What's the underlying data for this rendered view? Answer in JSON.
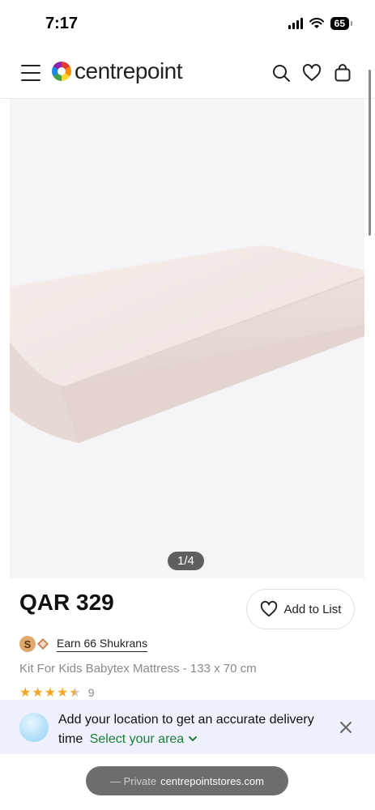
{
  "status_bar": {
    "time": "7:17",
    "battery": "65"
  },
  "header": {
    "logo_text": "centrepoint",
    "icons": [
      "menu-icon",
      "search-icon",
      "heart-icon",
      "bag-icon"
    ]
  },
  "gallery": {
    "pager": "1/4"
  },
  "product": {
    "price": "QAR 329",
    "add_to_list": "Add to List",
    "shukran_coin": "S",
    "shukran_label": "Earn 66 Shukrans",
    "title": "Kit For Kids Babytex Mattress - 133 x 70 cm",
    "rating_value": 4.5,
    "rating_count": "9"
  },
  "location_banner": {
    "message": "Add your location to get an accurate delivery time",
    "cta": "Select your area"
  },
  "url_bar": {
    "private": "— Private",
    "domain": "centrepointstores.com"
  },
  "colors": {
    "accent_green": "#1a7f37",
    "star": "#f5a623",
    "banner_bg": "#eef1fb"
  }
}
